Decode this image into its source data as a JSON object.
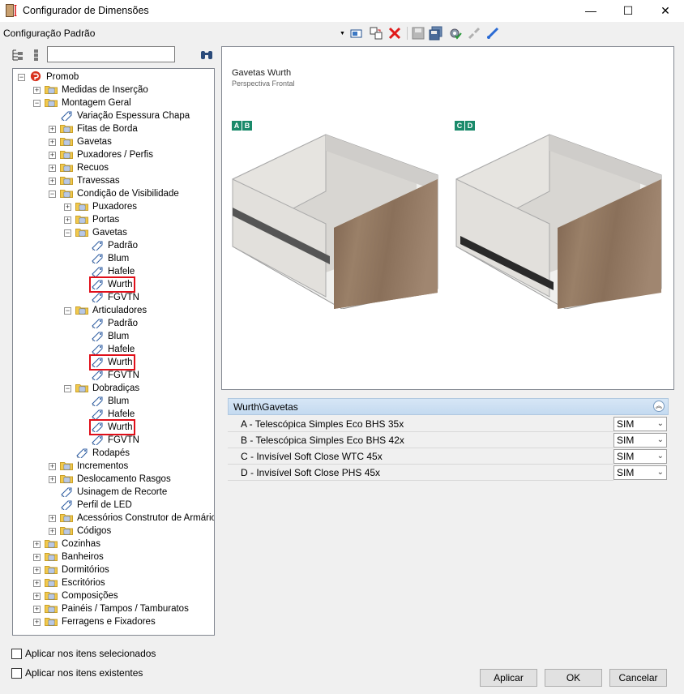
{
  "window": {
    "title": "Configurador de Dimensões",
    "minimize_glyph": "—",
    "maximize_glyph": "☐",
    "close_glyph": "✕"
  },
  "config": {
    "label": "Configuração Padrão"
  },
  "toolbar": {
    "icons": [
      "select-icon",
      "copy-config-icon",
      "delete-icon",
      "save-icon",
      "save-all-icon",
      "settings-icon",
      "unlink-icon",
      "link-icon"
    ]
  },
  "tree_search": {
    "value": ""
  },
  "tree": {
    "items": [
      {
        "label": "Promob",
        "level": 0,
        "exp": "-",
        "icon": "promob"
      },
      {
        "label": "Medidas de Inserção",
        "level": 1,
        "exp": "+",
        "icon": "folder"
      },
      {
        "label": "Montagem Geral",
        "level": 1,
        "exp": "-",
        "icon": "folder"
      },
      {
        "label": "Variação Espessura Chapa",
        "level": 2,
        "exp": "",
        "icon": "tag"
      },
      {
        "label": "Fitas de Borda",
        "level": 2,
        "exp": "+",
        "icon": "folder"
      },
      {
        "label": "Gavetas",
        "level": 2,
        "exp": "+",
        "icon": "folder"
      },
      {
        "label": "Puxadores / Perfis",
        "level": 2,
        "exp": "+",
        "icon": "folder"
      },
      {
        "label": "Recuos",
        "level": 2,
        "exp": "+",
        "icon": "folder"
      },
      {
        "label": "Travessas",
        "level": 2,
        "exp": "+",
        "icon": "folder"
      },
      {
        "label": "Condição de Visibilidade",
        "level": 2,
        "exp": "-",
        "icon": "folder"
      },
      {
        "label": "Puxadores",
        "level": 3,
        "exp": "+",
        "icon": "folder"
      },
      {
        "label": "Portas",
        "level": 3,
        "exp": "+",
        "icon": "folder"
      },
      {
        "label": "Gavetas",
        "level": 3,
        "exp": "-",
        "icon": "folder"
      },
      {
        "label": "Padrão",
        "level": 4,
        "exp": "",
        "icon": "tag"
      },
      {
        "label": "Blum",
        "level": 4,
        "exp": "",
        "icon": "tag"
      },
      {
        "label": "Hafele",
        "level": 4,
        "exp": "",
        "icon": "tag"
      },
      {
        "label": "Wurth",
        "level": 4,
        "exp": "",
        "icon": "tag",
        "highlight": true
      },
      {
        "label": "FGVTN",
        "level": 4,
        "exp": "",
        "icon": "tag"
      },
      {
        "label": "Articuladores",
        "level": 3,
        "exp": "-",
        "icon": "folder"
      },
      {
        "label": "Padrão",
        "level": 4,
        "exp": "",
        "icon": "tag"
      },
      {
        "label": "Blum",
        "level": 4,
        "exp": "",
        "icon": "tag"
      },
      {
        "label": "Hafele",
        "level": 4,
        "exp": "",
        "icon": "tag"
      },
      {
        "label": "Wurth",
        "level": 4,
        "exp": "",
        "icon": "tag",
        "highlight": true
      },
      {
        "label": "FGVTN",
        "level": 4,
        "exp": "",
        "icon": "tag"
      },
      {
        "label": "Dobradiças",
        "level": 3,
        "exp": "-",
        "icon": "folder"
      },
      {
        "label": "Blum",
        "level": 4,
        "exp": "",
        "icon": "tag"
      },
      {
        "label": "Hafele",
        "level": 4,
        "exp": "",
        "icon": "tag"
      },
      {
        "label": "Wurth",
        "level": 4,
        "exp": "",
        "icon": "tag",
        "highlight": true
      },
      {
        "label": "FGVTN",
        "level": 4,
        "exp": "",
        "icon": "tag"
      },
      {
        "label": "Rodapés",
        "level": 3,
        "exp": "",
        "icon": "tag"
      },
      {
        "label": "Incrementos",
        "level": 2,
        "exp": "+",
        "icon": "folder"
      },
      {
        "label": "Deslocamento Rasgos",
        "level": 2,
        "exp": "+",
        "icon": "folder"
      },
      {
        "label": "Usinagem de Recorte",
        "level": 2,
        "exp": "",
        "icon": "tag"
      },
      {
        "label": "Perfil de LED",
        "level": 2,
        "exp": "",
        "icon": "tag"
      },
      {
        "label": "Acessórios Construtor de Armários",
        "level": 2,
        "exp": "+",
        "icon": "folder"
      },
      {
        "label": "Códigos",
        "level": 2,
        "exp": "+",
        "icon": "folder"
      },
      {
        "label": "Cozinhas",
        "level": 1,
        "exp": "+",
        "icon": "folder"
      },
      {
        "label": "Banheiros",
        "level": 1,
        "exp": "+",
        "icon": "folder"
      },
      {
        "label": "Dormitórios",
        "level": 1,
        "exp": "+",
        "icon": "folder"
      },
      {
        "label": "Escritórios",
        "level": 1,
        "exp": "+",
        "icon": "folder"
      },
      {
        "label": "Composições",
        "level": 1,
        "exp": "+",
        "icon": "folder"
      },
      {
        "label": "Painéis / Tampos / Tamburatos",
        "level": 1,
        "exp": "+",
        "icon": "folder"
      },
      {
        "label": "Ferragens e Fixadores",
        "level": 1,
        "exp": "+",
        "icon": "folder"
      }
    ]
  },
  "preview": {
    "title": "Gavetas Wurth",
    "subtitle": "Perspectiva Frontal",
    "badges_left": [
      "A",
      "B"
    ],
    "badges_right": [
      "C",
      "D"
    ]
  },
  "grid": {
    "title": "Wurth\\Gavetas",
    "rows": [
      {
        "label": "A - Telescópica Simples Eco BHS 35x",
        "value": "SIM"
      },
      {
        "label": "B - Telescópica Simples Eco BHS 42x",
        "value": "SIM"
      },
      {
        "label": "C - Invisível Soft Close WTC 45x",
        "value": "SIM"
      },
      {
        "label": "D - Invisível Soft Close PHS 45x",
        "value": "SIM"
      }
    ]
  },
  "bottom": {
    "apply_selected": "Aplicar nos itens selecionados",
    "apply_existing": "Aplicar nos itens existentes",
    "btn_apply": "Aplicar",
    "btn_ok": "OK",
    "btn_cancel": "Cancelar"
  },
  "colors": {
    "accent": "#1a8a6a",
    "highlight": "#e0101a",
    "folder": "#f2c94c",
    "grid_header": "#c8ddf2"
  }
}
